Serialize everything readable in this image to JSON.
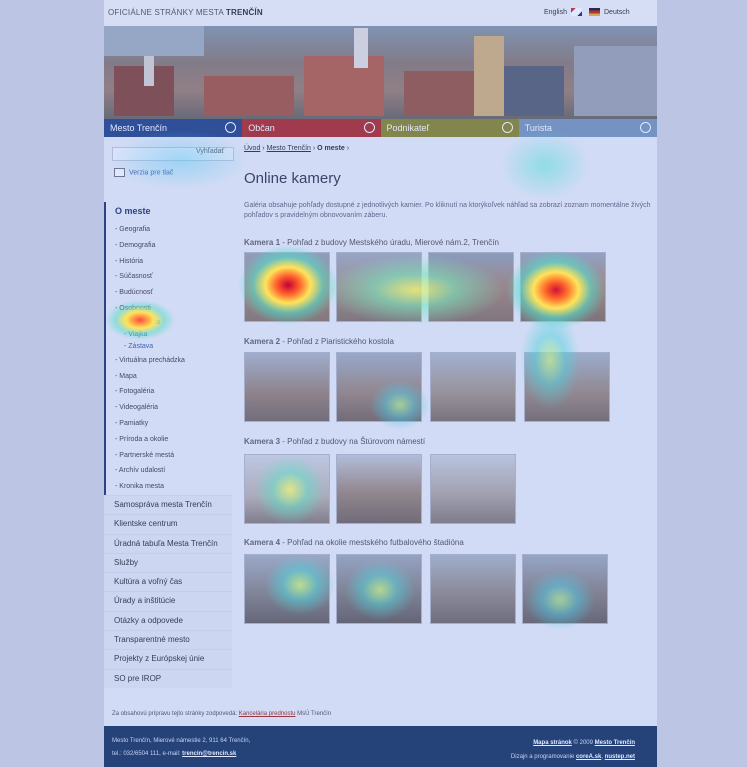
{
  "header": {
    "site_title_pre": "OFICIÁLNE STRÁNKY MESTA ",
    "site_title_city": "TRENČÍN",
    "lang_en": "English",
    "lang_de": "Deutsch"
  },
  "mainnav": [
    {
      "label": "Mesto Trenčín",
      "color": "#2c4a86"
    },
    {
      "label": "Občan",
      "color": "#b2322c"
    },
    {
      "label": "Podnikateľ",
      "color": "#8e8a2a"
    },
    {
      "label": "Turista",
      "color": "#7e9ab8"
    }
  ],
  "search": {
    "label": "Vyhľadať"
  },
  "print_label": "Verzia pre tlač",
  "sidebar": {
    "head": "O meste",
    "subs": [
      "Geografia",
      "Demografia",
      "História",
      "Súčasnosť",
      "Budúcnosť",
      "Osobnosti"
    ],
    "subs2": [
      "Erb mesta",
      "Vlajka",
      "Zástava"
    ],
    "subs3": [
      "Virtuálna prechádzka",
      "Mapa",
      "Fotogaléria",
      "Videogaléria",
      "Pamiatky",
      "Príroda a okolie",
      "Partnerské mestá",
      "Archív udalostí",
      "Kronika mesta"
    ],
    "main": [
      "Samospráva mesta Trenčín",
      "Klientske centrum",
      "Úradná tabuľa Mesta Trenčín",
      "Služby",
      "Kultúra a voľný čas",
      "Úrady a inštitúcie",
      "Otázky a odpovede",
      "Transparentné mesto",
      "Projekty z Európskej únie",
      "SO pre IROP"
    ]
  },
  "breadcrumb": {
    "home": "Úvod",
    "city": "Mesto Trenčín",
    "current": "O meste"
  },
  "page_title": "Online kamery",
  "intro": "Galéria obsahuje pohľady dostupné z jednotlivých kamier. Po kliknutí na ktorýkoľvek náhľad sa zobrazí zoznam momentálne živých pohľadov s pravidelným obnovovaním záberu.",
  "cameras": [
    {
      "label": "Kamera 1",
      "desc": " - Pohľad z budovy Mestského úradu, Mierové nám.2, Trenčín"
    },
    {
      "label": "Kamera 2",
      "desc": " - Pohľad z Piaristického kostola"
    },
    {
      "label": "Kamera 3",
      "desc": " - Pohľad z budovy na Štúrovom námestí"
    },
    {
      "label": "Kamera 4",
      "desc": " - Pohľad na okolie mestského futbalového štadióna"
    }
  ],
  "footnote": {
    "pre": "Za obsahovú prípravu tejto stránky zodpovedá: ",
    "link": "Kancelária prednostu",
    "post": " MsÚ Trenčín"
  },
  "footer": {
    "address": "Mesto Trenčín, Mierové námestie 2, 911 64 Trenčín,",
    "contact_pre": "tel.: 032/6504 111, e-mail: ",
    "email": "trencin@trencin.sk",
    "sitemap": "Mapa stránok",
    "copy": " © 2009 ",
    "owner": "Mesto Trenčín",
    "design_pre": "Dizajn a programovanie ",
    "design1": "coreA.sk",
    "design2": "nustep.net"
  }
}
